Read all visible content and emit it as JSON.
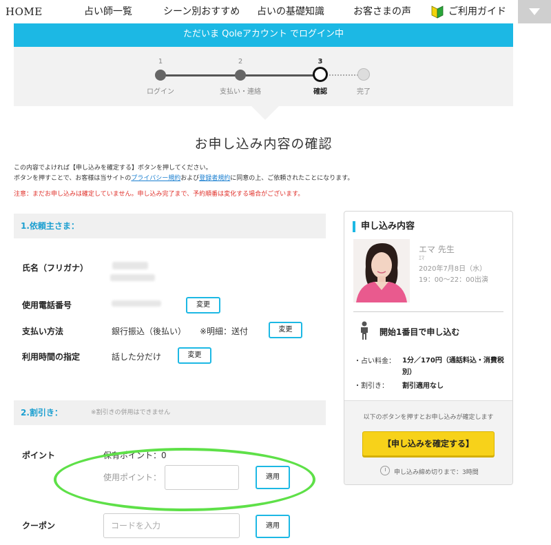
{
  "nav": {
    "home": "HOME",
    "fortune_tellers": "占い師一覧",
    "by_scene": "シーン別おすすめ",
    "basics": "占いの基礎知識",
    "reviews": "お客さまの声",
    "guide": "ご利用ガイド"
  },
  "banner": {
    "text": "ただいま Qoleアカウント でログイン中"
  },
  "steps": [
    {
      "num": "1",
      "label": "ログイン"
    },
    {
      "num": "2",
      "label": "支払い・連絡"
    },
    {
      "num": "3",
      "label": "確認"
    },
    {
      "num": "",
      "label": "完了"
    }
  ],
  "page": {
    "title": "お申し込み内容の確認",
    "instr1": "この内容でよければ【申し込みを確定する】ボタンを押してください。",
    "instr2_a": "ボタンを押すことで、お客様は当サイトの",
    "privacy_link": "プライバシー規約",
    "instr2_b": "および",
    "terms_link": "登録者規約",
    "instr2_c": "に同意の上、ご依頼されたことになります。",
    "warning": "注意：まだお申し込みは確定していません。申し込み完了まで、予約順番は変化する場合がございます。"
  },
  "client": {
    "section_title": "1.依頼主さま：",
    "name_label": "氏名（フリガナ）",
    "phone_label": "使用電話番号",
    "phone_change": "変更",
    "payment_label": "支払い方法",
    "payment_value": "銀行振込（後払い）",
    "payment_detail": "※明細：送付",
    "payment_change": "変更",
    "time_label": "利用時間の指定",
    "time_value": "話した分だけ",
    "time_change": "変更"
  },
  "discount": {
    "section_title": "2.割引き：",
    "section_note": "※割引きの併用はできません",
    "points_label": "ポイント",
    "points_owned": "保有ポイント：0",
    "points_use_placeholder": "使用ポイント：",
    "points_apply": "適用",
    "coupon_label": "クーポン",
    "coupon_placeholder": "コードを入力",
    "coupon_apply": "適用"
  },
  "summary": {
    "title": "申し込み内容",
    "teller_name": "エマ 先生",
    "teller_kana": "ｴﾏ",
    "date": "2020年7月8日（水）",
    "time": "19：00〜22：00出演",
    "order": "開始1番目で申し込む",
    "fee_label": "・占い料金：",
    "fee_value": "1分／170円（通話料込・消費税別）",
    "discount_label": "・割引き：",
    "discount_value": "割引適用なし",
    "confirm_note": "以下のボタンを押すとお申し込みが確定します",
    "confirm_button": "【申し込みを確定する】",
    "deadline": "申し込み締め切りまで：3時間"
  },
  "colors": {
    "accent_blue": "#1cb8e4",
    "confirm_yellow": "#f7d21a",
    "warning_red": "#e0302a",
    "annotation_green": "#5ee048"
  }
}
